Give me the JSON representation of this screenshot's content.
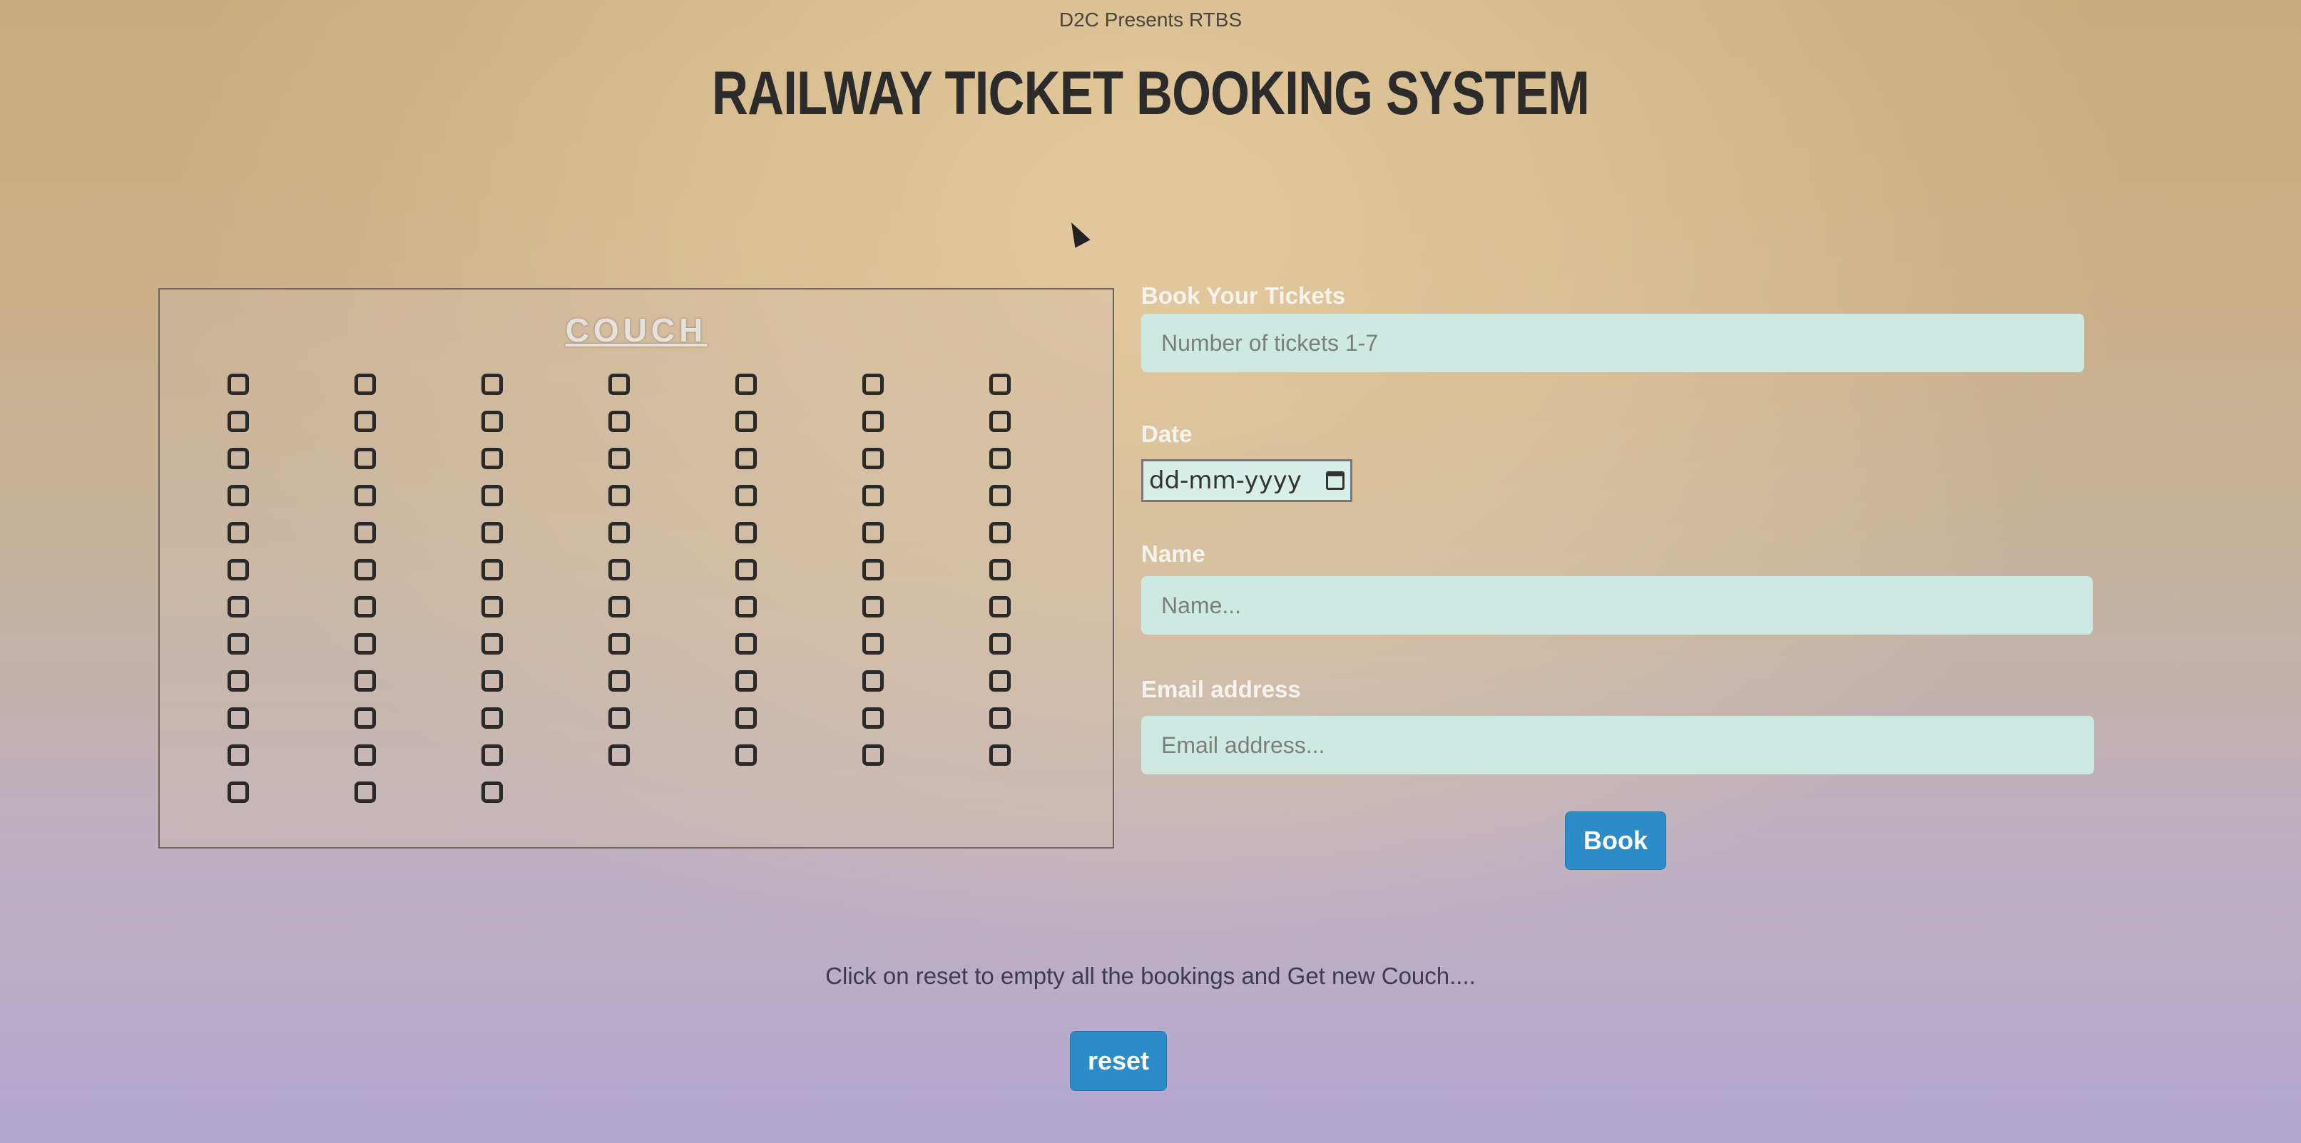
{
  "header": {
    "caption": "D2C Presents RTBS",
    "title": "RAILWAY TICKET BOOKING SYSTEM"
  },
  "couch": {
    "title": "COUCH",
    "rows": 12,
    "columns": 7,
    "seat_count": 80
  },
  "form": {
    "tickets_label": "Book Your Tickets",
    "tickets_placeholder": "Number of tickets 1-7",
    "date_label": "Date",
    "date_placeholder": "dd-mm-yyyy",
    "name_label": "Name",
    "name_placeholder": "Name...",
    "email_label": "Email address",
    "email_placeholder": "Email address...",
    "book_button": "Book"
  },
  "footer": {
    "note": "Click on reset to empty all the bookings and Get new Couch....",
    "reset_button": "reset"
  },
  "colors": {
    "button": "#2c8cc8",
    "input_bg": "#cde9e2"
  }
}
